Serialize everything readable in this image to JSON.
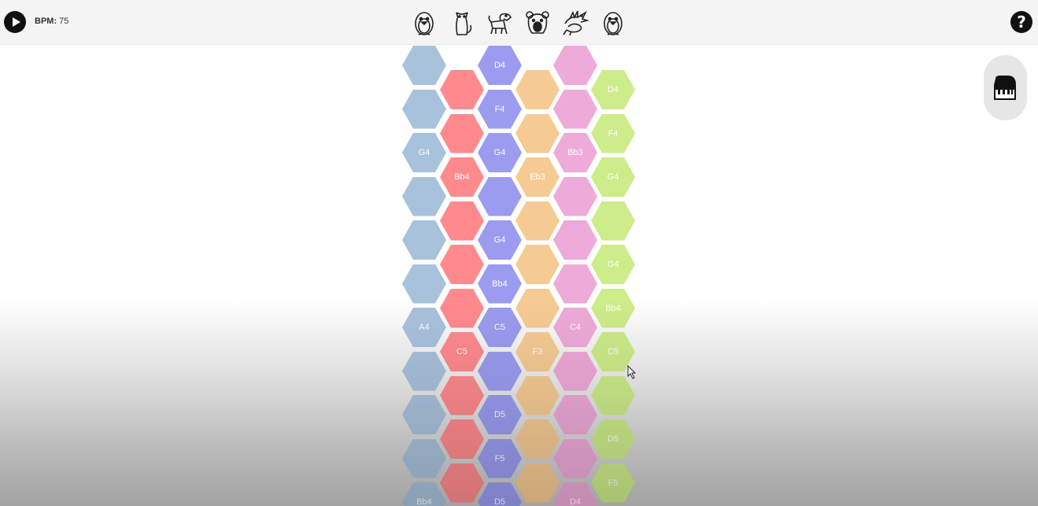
{
  "header": {
    "play_icon": "play-icon",
    "bpm_label": "BPM:",
    "bpm_value": "75",
    "animals": [
      {
        "name": "penguin-icon"
      },
      {
        "name": "cat-icon"
      },
      {
        "name": "dog-icon"
      },
      {
        "name": "bear-icon"
      },
      {
        "name": "dragon-icon"
      },
      {
        "name": "penguin-icon"
      }
    ],
    "help_label": "?"
  },
  "side": {
    "piano_icon": "piano-icon"
  },
  "grid": {
    "columns": [
      {
        "color": "#a9c2dc",
        "notes": [
          "",
          "",
          "G4",
          "",
          "",
          "",
          "A4",
          "",
          "",
          "",
          "Bb4"
        ]
      },
      {
        "color": "#ff8a8e",
        "notes": [
          "",
          "",
          "Bb4",
          "",
          "",
          "",
          "C5",
          "",
          "",
          ""
        ]
      },
      {
        "color": "#9b9cf0",
        "notes": [
          "D4",
          "F4",
          "G4",
          "",
          "G4",
          "Bb4",
          "C5",
          "",
          "D5",
          "F5",
          "D5"
        ]
      },
      {
        "color": "#f6cb93",
        "notes": [
          "",
          "",
          "Eb3",
          "",
          "",
          "",
          "F3",
          "",
          "",
          ""
        ]
      },
      {
        "color": "#eeaad8",
        "notes": [
          "",
          "",
          "Bb3",
          "",
          "",
          "",
          "C4",
          "",
          "",
          "",
          "D4"
        ]
      },
      {
        "color": "#cdec8a",
        "notes": [
          "D4",
          "F4",
          "G4",
          "",
          "G4",
          "Bb4",
          "C5",
          "",
          "D5",
          "F5"
        ]
      }
    ]
  }
}
